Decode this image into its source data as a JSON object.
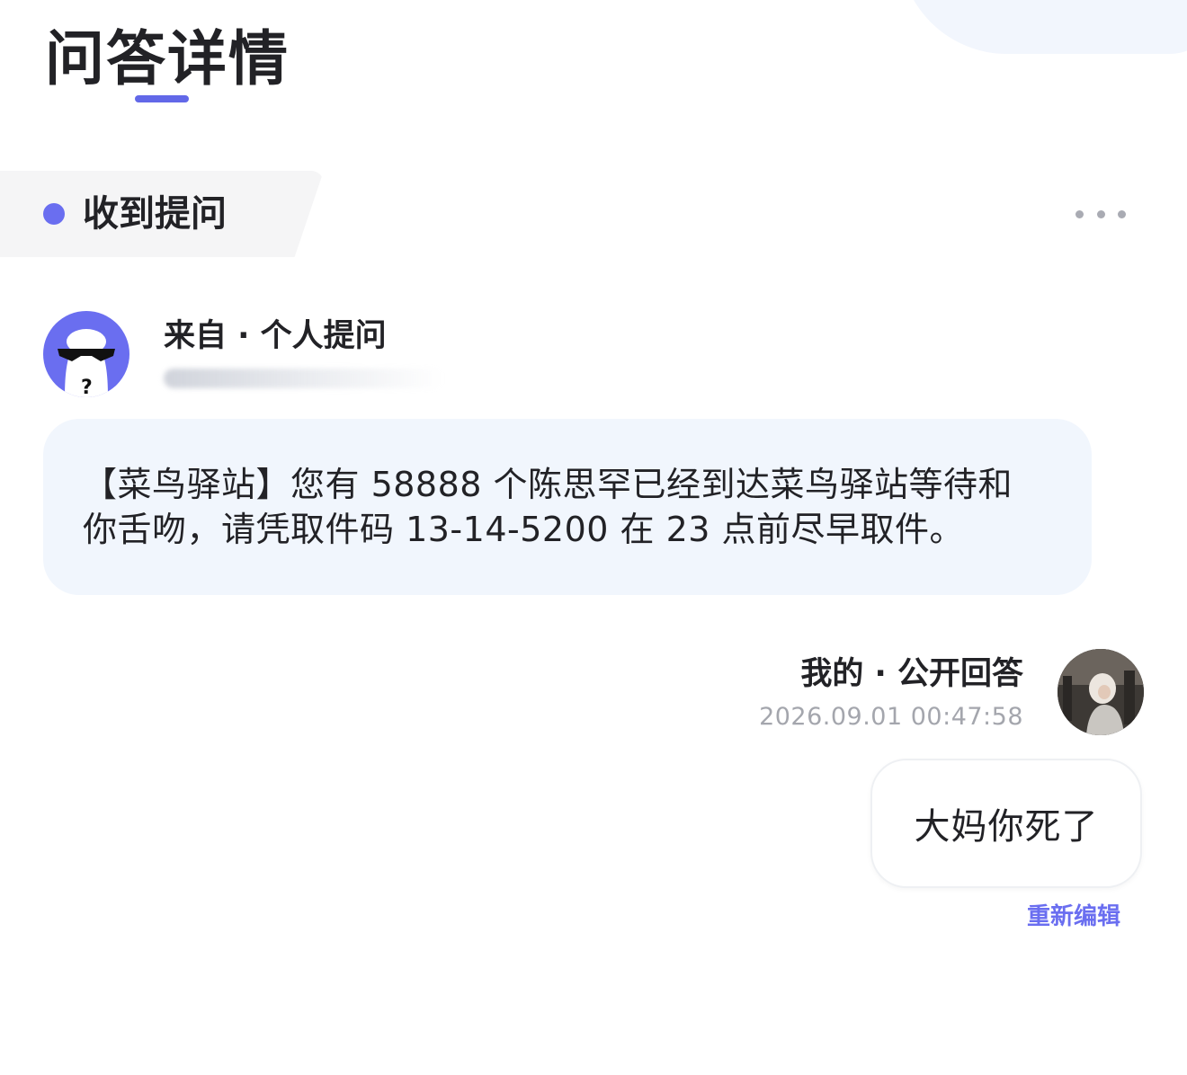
{
  "page": {
    "title": "问答详情",
    "accent_color": "#6a6ef0"
  },
  "section": {
    "label": "收到提问",
    "more_icon": "more-horizontal-icon"
  },
  "question": {
    "source_label": "来自 · 个人提问",
    "avatar_icon": "anonymous-sunglasses-avatar",
    "text": "【菜鸟驿站】您有 58888 个陈思罕已经到达菜鸟驿站等待和你舌吻，请凭取件码 13-14-5200 在 23 点前尽早取件。"
  },
  "answer": {
    "header": "我的 · 公开回答",
    "timestamp": "2026.09.01 00:47:58",
    "text": "大妈你死了",
    "re_edit_label": "重新编辑"
  }
}
